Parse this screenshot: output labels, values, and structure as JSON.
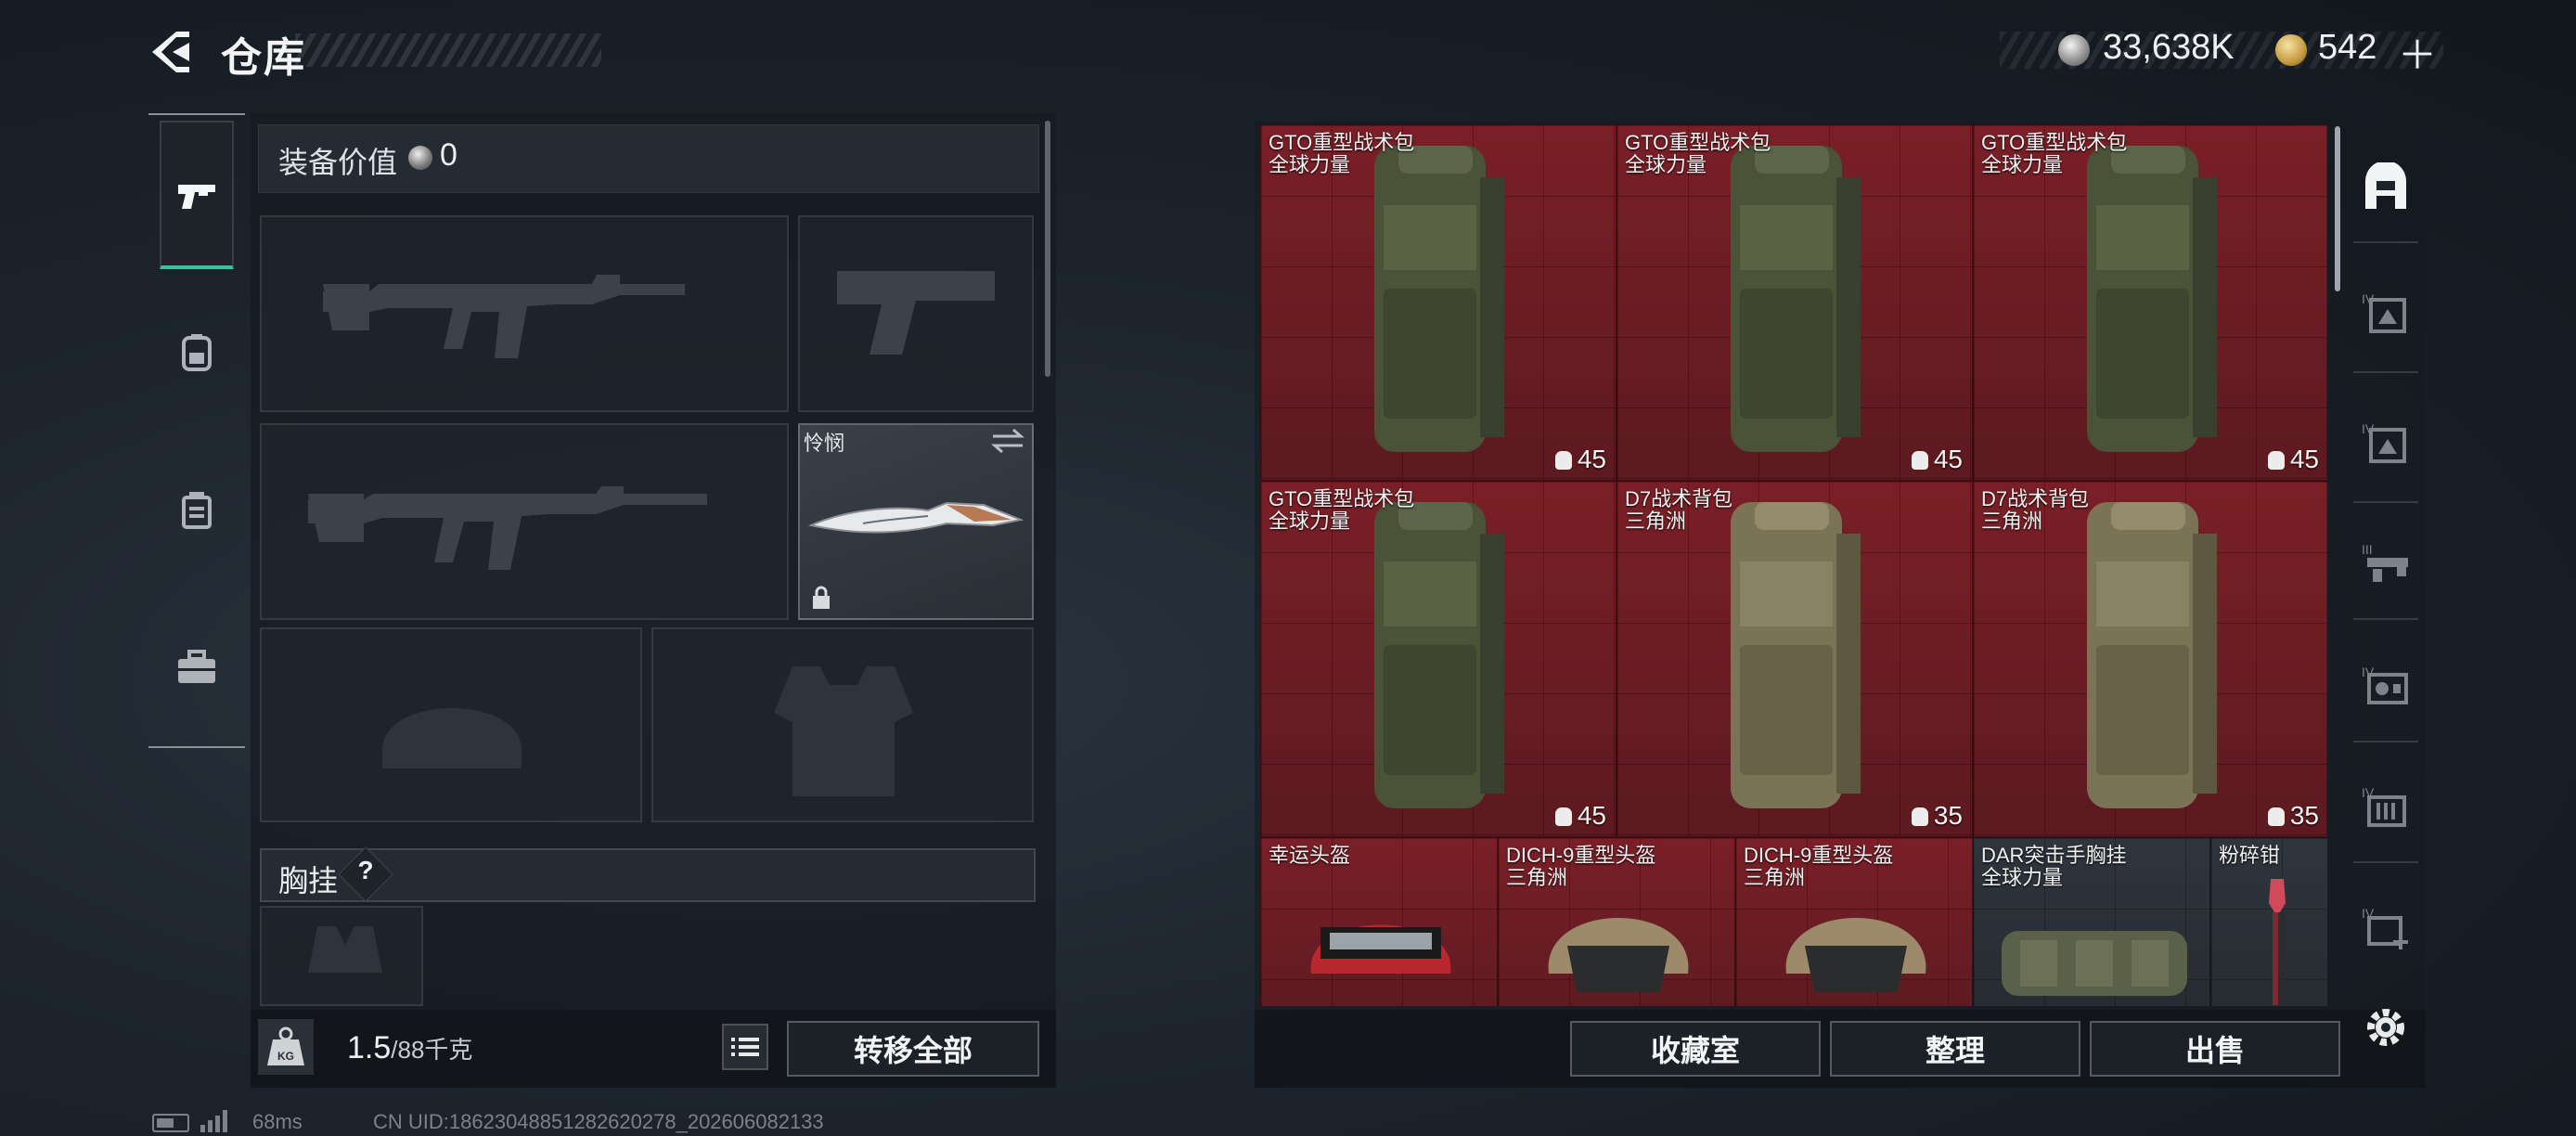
{
  "header": {
    "title": "仓库",
    "currency_silver": "33,638K",
    "currency_gold": "542",
    "currency_add": "＋"
  },
  "left_tabs": [
    {
      "name": "weapon-tab",
      "icon": "pistol-icon",
      "active": true
    },
    {
      "name": "gear-tab",
      "icon": "backpack-icon",
      "active": false
    },
    {
      "name": "armor-tab",
      "icon": "vest-icon",
      "active": false
    },
    {
      "name": "tools-tab",
      "icon": "toolbox-icon",
      "active": false
    }
  ],
  "loadout": {
    "equip_value_label": "装备价值",
    "equip_value": "0",
    "melee_name": "怜悯",
    "chest_rig_label": "胸挂",
    "help_mark": "?",
    "weight_current": "1.5",
    "weight_max": "/88千克",
    "transfer_all_label": "转移全部"
  },
  "stash_items": [
    {
      "name": "GTO重型战术包",
      "source": "全球力量",
      "capacity": "45",
      "kind": "backpack-green"
    },
    {
      "name": "GTO重型战术包",
      "source": "全球力量",
      "capacity": "45",
      "kind": "backpack-green"
    },
    {
      "name": "GTO重型战术包",
      "source": "全球力量",
      "capacity": "45",
      "kind": "backpack-green"
    },
    {
      "name": "GTO重型战术包",
      "source": "全球力量",
      "capacity": "45",
      "kind": "backpack-green"
    },
    {
      "name": "D7战术背包",
      "source": "三角洲",
      "capacity": "35",
      "kind": "backpack-tan"
    },
    {
      "name": "D7战术背包",
      "source": "三角洲",
      "capacity": "35",
      "kind": "backpack-tan"
    },
    {
      "name": "幸运头盔",
      "source": "",
      "capacity": "",
      "kind": "helmet-red"
    },
    {
      "name": "DICH-9重型头盔",
      "source": "三角洲",
      "capacity": "",
      "kind": "helmet-tan"
    },
    {
      "name": "DICH-9重型头盔",
      "source": "三角洲",
      "capacity": "",
      "kind": "helmet-tan"
    },
    {
      "name": "DAR突击手胸挂",
      "source": "全球力量",
      "capacity": "",
      "kind": "chest-rig"
    },
    {
      "name": "粉碎钳",
      "source": "",
      "capacity": "",
      "kind": "pliers"
    }
  ],
  "stash_buttons": {
    "collection": "收藏室",
    "sort": "整理",
    "sell": "出售"
  },
  "right_nav": [
    {
      "name": "stash-home-icon",
      "tier": ""
    },
    {
      "name": "stash-page-icon",
      "tier": "IV"
    },
    {
      "name": "stash-page-icon",
      "tier": "IV"
    },
    {
      "name": "stash-page-icon",
      "tier": "III"
    },
    {
      "name": "stash-page-icon",
      "tier": "IV"
    },
    {
      "name": "stash-page-icon",
      "tier": "IV"
    },
    {
      "name": "stash-add-icon",
      "tier": "IV"
    }
  ],
  "footer": {
    "ping": "68ms",
    "uid": "CN UID:1862304885128262027​8_202606082133"
  },
  "colors": {
    "accent": "#36c29a",
    "cell_red": "#7a1f27"
  }
}
